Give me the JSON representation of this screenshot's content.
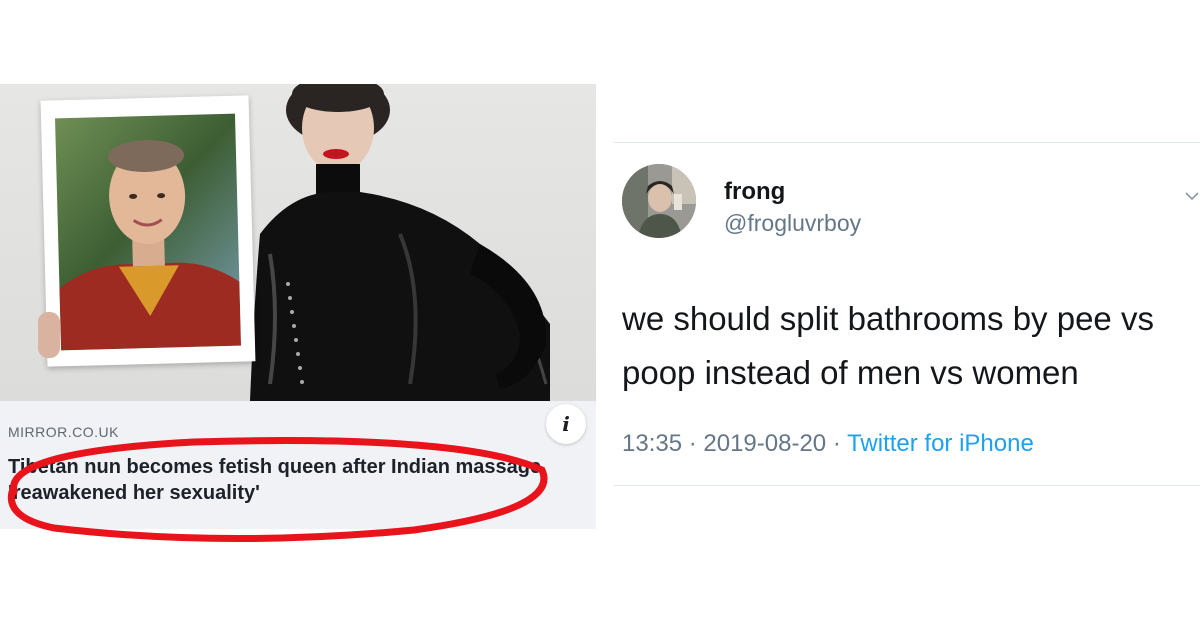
{
  "news_card": {
    "source": "MIRROR.CO.UK",
    "headline": "Tibetan nun becomes fetish queen after Indian massage 'reawakened her sexuality'",
    "info_glyph": "i",
    "annotation_color": "#e8131b"
  },
  "tweet": {
    "display_name": "frong",
    "handle": "@frogluvrboy",
    "text": "we should split bathrooms by pee vs poop instead of men vs women",
    "time": "13:35",
    "separator": " · ",
    "date": "2019-08-20",
    "client": "Twitter for iPhone",
    "link_color": "#1da1f2"
  },
  "icons": {
    "info": "info-icon",
    "menu": "chevron-down-icon"
  }
}
